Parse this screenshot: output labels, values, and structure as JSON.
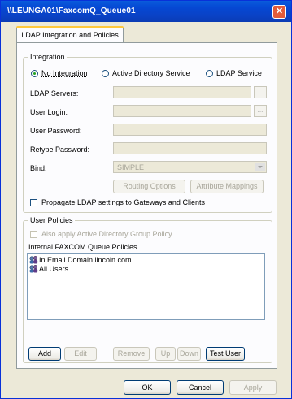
{
  "window": {
    "title": "\\\\LEUNGA01\\FaxcomQ_Queue01"
  },
  "tabs": [
    {
      "label": "LDAP Integration and Policies"
    }
  ],
  "integration": {
    "group_label": "Integration",
    "radios": [
      {
        "label": "No Integration",
        "selected": true
      },
      {
        "label": "Active Directory Service",
        "selected": false
      },
      {
        "label": "LDAP Service",
        "selected": false
      }
    ],
    "fields": {
      "ldap_servers": {
        "label": "LDAP Servers:",
        "value": ""
      },
      "user_login": {
        "label": "User Login:",
        "value": ""
      },
      "user_password": {
        "label": "User Password:",
        "value": ""
      },
      "retype_password": {
        "label": "Retype Password:",
        "value": ""
      },
      "bind": {
        "label": "Bind:",
        "value": "SIMPLE"
      }
    },
    "browse_label": "...",
    "routing_options": "Routing Options",
    "attribute_mappings": "Attribute Mappings",
    "propagate_label": "Propagate LDAP settings to Gateways and Clients"
  },
  "user_policies": {
    "group_label": "User Policies",
    "also_apply_label": "Also apply Active Directory Group Policy",
    "list_title": "Internal FAXCOM Queue Policies",
    "items": [
      {
        "label": "In Email Domain lincoln.com",
        "icon": "users-group-icon"
      },
      {
        "label": "All Users",
        "icon": "users-group-icon"
      }
    ],
    "buttons": {
      "add": "Add",
      "edit": "Edit",
      "remove": "Remove",
      "up": "Up",
      "down": "Down",
      "test_user": "Test User"
    }
  },
  "footer": {
    "ok": "OK",
    "cancel": "Cancel",
    "apply": "Apply"
  }
}
